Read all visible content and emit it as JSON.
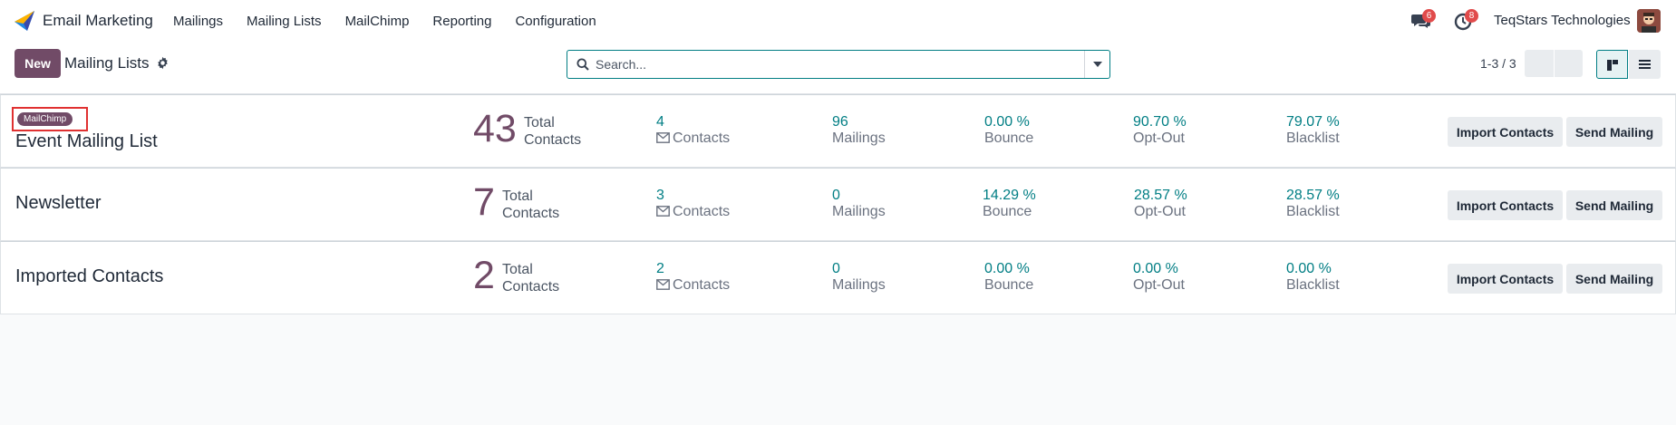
{
  "navbar": {
    "app_name": "Email Marketing",
    "menu": [
      "Mailings",
      "Mailing Lists",
      "MailChimp",
      "Reporting",
      "Configuration"
    ],
    "messages_count": "6",
    "activities_count": "8",
    "company": "TeqStars Technologies"
  },
  "control": {
    "new_label": "New",
    "breadcrumb": "Mailing Lists",
    "search_placeholder": "Search...",
    "pager": "1-3 / 3"
  },
  "rows": [
    {
      "tag": "MailChimp",
      "name": "Event Mailing List",
      "total": "43",
      "total_label_1": "Total",
      "total_label_2": "Contacts",
      "contacts": "4",
      "contacts_label": "Contacts",
      "mailings": "96",
      "mailings_label": "Mailings",
      "bounce": "0.00 %",
      "bounce_label": "Bounce",
      "optout": "90.70 %",
      "optout_label": "Opt-Out",
      "blacklist": "79.07 %",
      "blacklist_label": "Blacklist",
      "import_label": "Import Contacts",
      "send_label": "Send Mailing"
    },
    {
      "name": "Newsletter",
      "total": "7",
      "total_label_1": "Total",
      "total_label_2": "Contacts",
      "contacts": "3",
      "contacts_label": "Contacts",
      "mailings": "0",
      "mailings_label": "Mailings",
      "bounce": "14.29 %",
      "bounce_label": "Bounce",
      "optout": "28.57 %",
      "optout_label": "Opt-Out",
      "blacklist": "28.57 %",
      "blacklist_label": "Blacklist",
      "import_label": "Import Contacts",
      "send_label": "Send Mailing"
    },
    {
      "name": "Imported Contacts",
      "total": "2",
      "total_label_1": "Total",
      "total_label_2": "Contacts",
      "contacts": "2",
      "contacts_label": "Contacts",
      "mailings": "0",
      "mailings_label": "Mailings",
      "bounce": "0.00 %",
      "bounce_label": "Bounce",
      "optout": "0.00 %",
      "optout_label": "Opt-Out",
      "blacklist": "0.00 %",
      "blacklist_label": "Blacklist",
      "import_label": "Import Contacts",
      "send_label": "Send Mailing"
    }
  ],
  "colors": {
    "brand": "#714b67",
    "accent": "#017e84",
    "badge": "#e14b4b",
    "highlight_box": "#e03131"
  },
  "icons": [
    "app-logo-icon",
    "chat-icon",
    "clock-icon",
    "gear-icon",
    "search-icon",
    "caret-down-icon",
    "kanban-view-icon",
    "list-view-icon",
    "envelope-icon"
  ]
}
